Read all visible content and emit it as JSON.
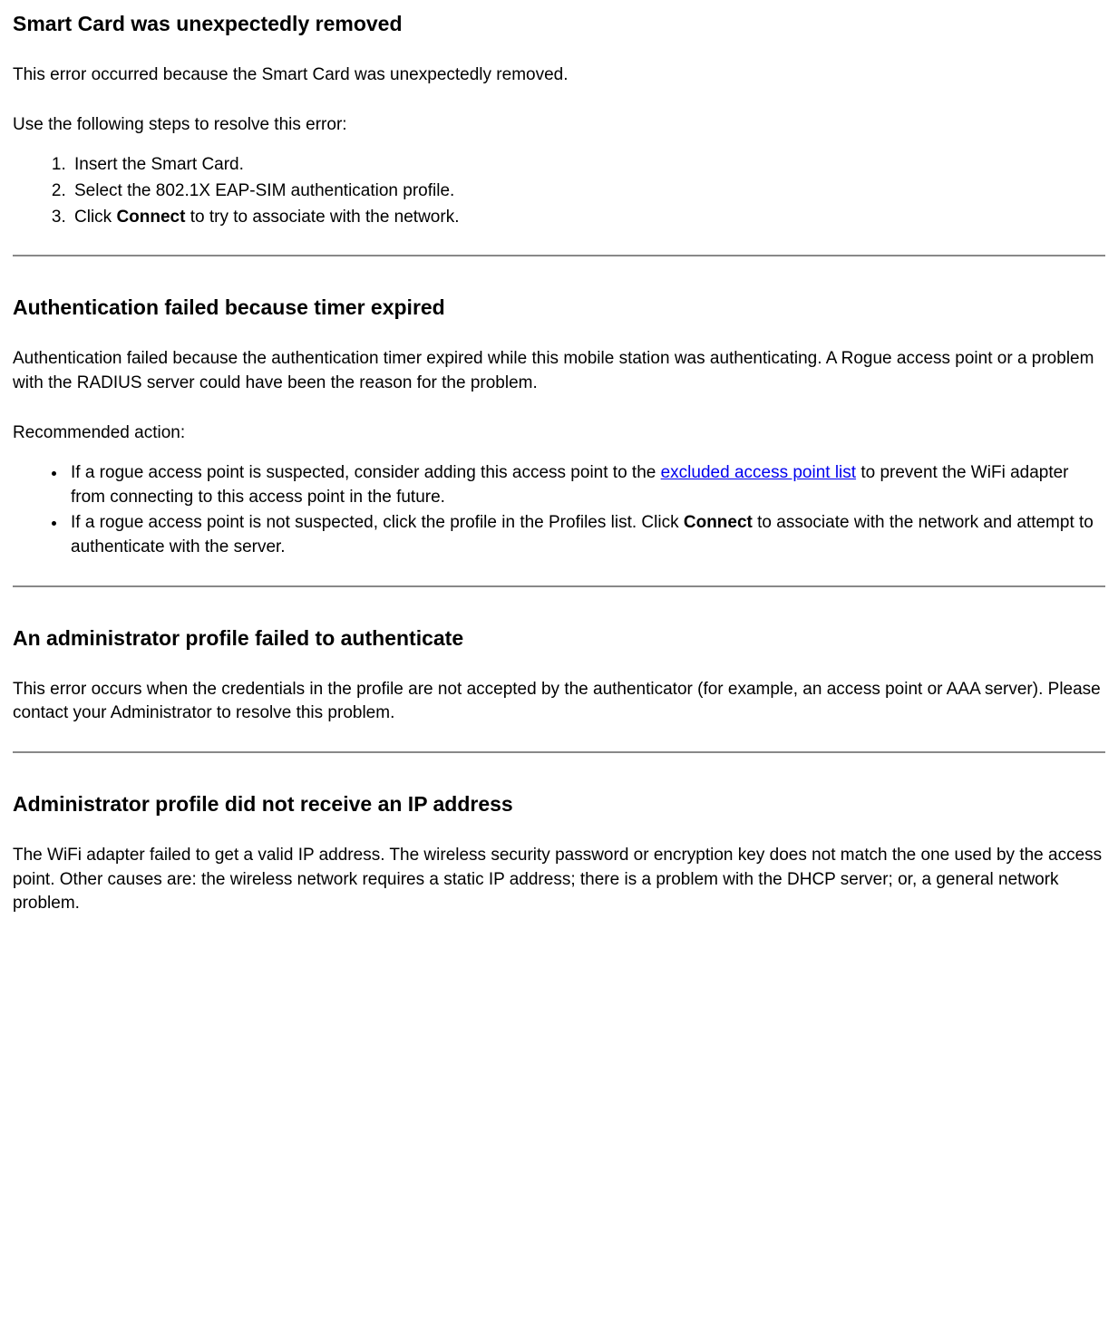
{
  "section1": {
    "heading": "Smart Card was unexpectedly removed",
    "p1": "This error occurred because the Smart Card was unexpectedly removed.",
    "p2": "Use the following steps to resolve this error:",
    "steps": {
      "s1": "Insert the Smart Card.",
      "s2": "Select the 802.1X EAP-SIM authentication profile.",
      "s3_pre": "Click ",
      "s3_bold": "Connect",
      "s3_post": " to try to associate with the network."
    }
  },
  "section2": {
    "heading": "Authentication failed because timer expired",
    "p1": "Authentication failed because the authentication timer expired while this mobile station was authenticating. A Rogue access point or a problem with the RADIUS server could have been the reason for the problem.",
    "p2": "Recommended action:",
    "bullets": {
      "b1_pre": "If a rogue access point is suspected, consider adding this access point to the ",
      "b1_link": "excluded access point list",
      "b1_post": " to prevent the WiFi adapter from connecting to this access point in the future.",
      "b2_pre": "If a rogue access point is not suspected, click the profile in the Profiles list. Click ",
      "b2_bold": "Connect",
      "b2_post": " to associate with the network and attempt to authenticate with the server."
    }
  },
  "section3": {
    "heading": "An administrator profile failed to authenticate",
    "p1": "This error occurs when the credentials in the profile are not accepted by the authenticator (for example, an access point or AAA server). Please contact your Administrator to resolve this problem."
  },
  "section4": {
    "heading": "Administrator profile did not receive an IP address",
    "p1": "The WiFi adapter failed to get a valid IP address. The wireless security password or encryption key does not match the one used by the access point. Other causes are: the wireless network requires a static IP address; there is a problem with the DHCP server; or, a general network problem."
  }
}
